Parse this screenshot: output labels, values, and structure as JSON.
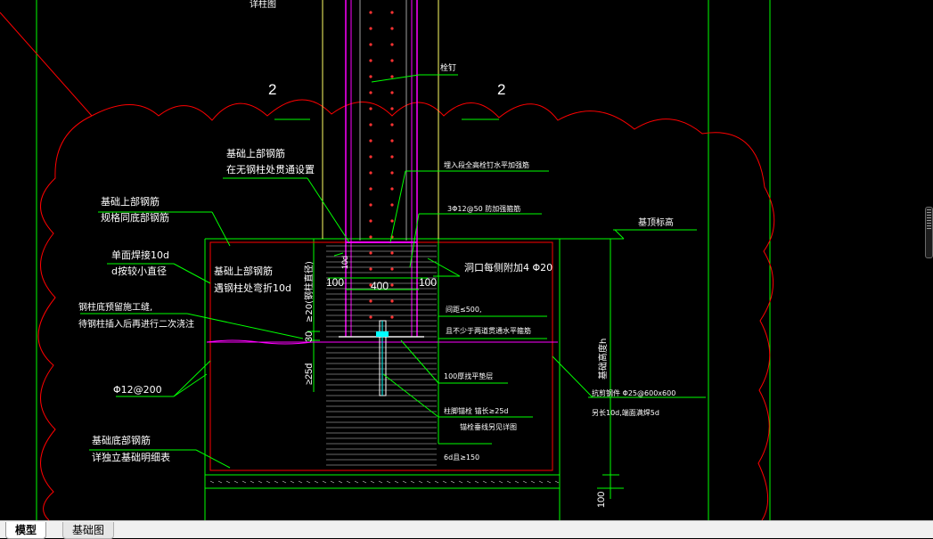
{
  "colors": {
    "background": "#000000",
    "green": "#00ff00",
    "white": "#ffffff",
    "red": "#ff0000",
    "magenta": "#ff00ff",
    "yellow": "#ffff66",
    "cyan": "#00ffff",
    "gray": "#a0a0a0"
  },
  "labels": {
    "top_ref": "详柱图",
    "grid_left": "2",
    "grid_right": "2",
    "anchor_bolt": "栓钉",
    "top_rebar_1": "基础上部钢筋",
    "top_rebar_2": "在无钢柱处贯通设置",
    "top_rebar_3": "基础上部钢筋",
    "top_rebar_4": "规格同底部钢筋",
    "weld_1": "单面焊接10d",
    "weld_2": "d按较小直径",
    "bend_1": "基础上部钢筋",
    "bend_2": "遇钢柱处弯折10d",
    "slot_1": "钢柱底预留施工缝,",
    "slot_2": "待钢柱插入后再进行二次浇注",
    "rebar_spec": "Φ12@200",
    "bottom_rebar_1": "基础底部钢筋",
    "bottom_rebar_2": "详独立基础明细表",
    "embed_note": "埋入段全高栓钉水平加强筋",
    "stirrup_note": "3Φ12@50 防加强箍筋",
    "top_elev": "基顶标高",
    "hole_note": "洞口每侧附加4 Φ20",
    "spacing_note": "间距≤500,",
    "not_less_note": "且不少于两道贯通水平箍筋",
    "cushion_note": "100厚找平垫层",
    "anchor_length": "柱脚锚栓 锚长≥25d",
    "anchor_detail": "锚栓垂线另见详图",
    "six_d": "6d且≥150",
    "reinf_note_1": "抗剪钢件 Φ25@600x600",
    "reinf_note_2": "另长10d,端面满焊5d",
    "depth_label": "基础高度h",
    "dim_10d": "10d",
    "dim_20d": "≥20(钢柱直径)",
    "dim_100_left": "100",
    "dim_400": "400",
    "dim_100_right": "100",
    "dim_30": "30",
    "dim_25d": "≥25d",
    "dim_100_bottom": "100"
  },
  "tabs": {
    "model": "模型",
    "sheet": "基础图"
  }
}
